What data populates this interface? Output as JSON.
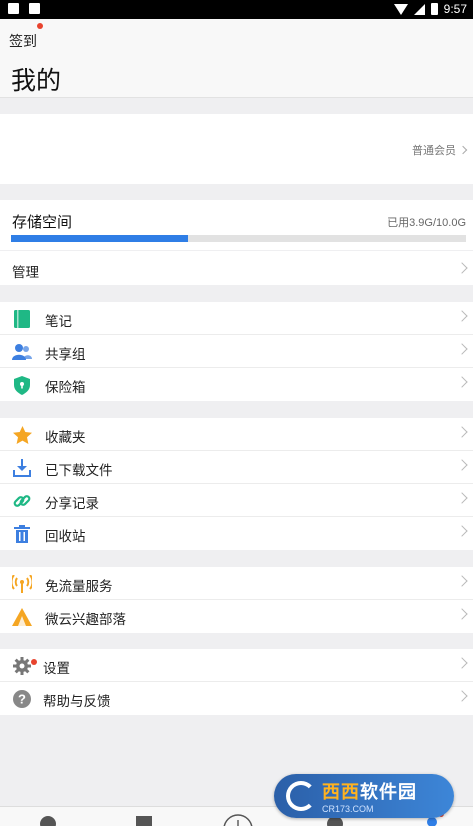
{
  "status_bar": {
    "time": "9:57"
  },
  "header": {
    "checkin_label": "签到",
    "title": "我的"
  },
  "profile": {
    "member_label": "普通会员"
  },
  "storage": {
    "title": "存储空间",
    "used_text": "已用3.9G/10.0G",
    "used_fraction": 0.39,
    "bar_color": "#2f7ee6"
  },
  "manage": {
    "label": "管理"
  },
  "group1": [
    {
      "label": "笔记",
      "icon": "note-icon",
      "color": "#1fb885"
    },
    {
      "label": "共享组",
      "icon": "share-group-icon",
      "color": "#3d7fe0"
    },
    {
      "label": "保险箱",
      "icon": "safe-icon",
      "color": "#1fb885"
    }
  ],
  "group2": [
    {
      "label": "收藏夹",
      "icon": "star-icon",
      "color": "#f5a623"
    },
    {
      "label": "已下载文件",
      "icon": "download-icon",
      "color": "#3d7fe0"
    },
    {
      "label": "分享记录",
      "icon": "link-icon",
      "color": "#1fb885"
    },
    {
      "label": "回收站",
      "icon": "trash-icon",
      "color": "#3d7fe0"
    }
  ],
  "group3": [
    {
      "label": "免流量服务",
      "icon": "antenna-icon",
      "color": "#f5a623"
    },
    {
      "label": "微云兴趣部落",
      "icon": "tent-icon",
      "color": "#f5a623"
    }
  ],
  "group4": [
    {
      "label": "设置",
      "icon": "gear-icon",
      "color": "#777777"
    },
    {
      "label": "帮助与反馈",
      "icon": "help-icon",
      "color": "#888888"
    }
  ],
  "watermark": {
    "main_a": "西西",
    "main_b": "软件园",
    "sub": "CR173.COM"
  }
}
